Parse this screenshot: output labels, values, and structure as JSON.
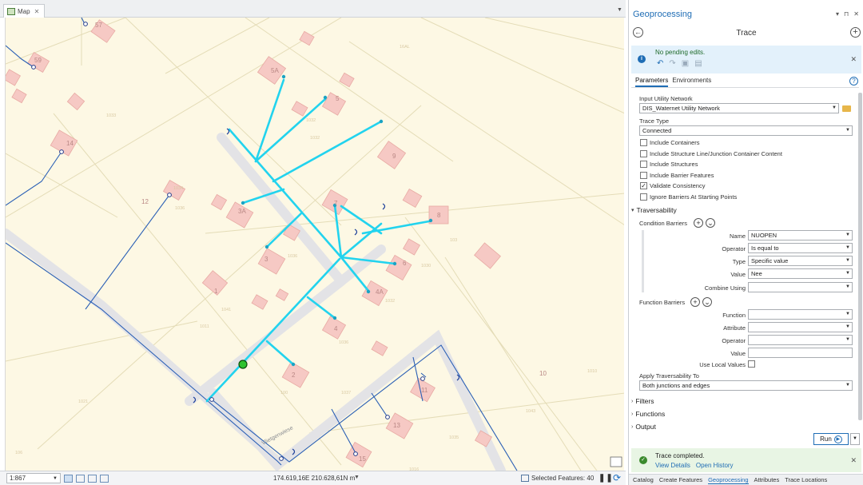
{
  "map_tab": {
    "label": "Map"
  },
  "map": {
    "parcel_labels": [
      "57",
      "59",
      "14",
      "12",
      "5A",
      "5",
      "9",
      "3A",
      "3",
      "7",
      "8",
      "6",
      "1",
      "4A",
      "4",
      "2",
      "11",
      "13",
      "15",
      "10"
    ],
    "faint_labels": [
      "16AL",
      "1032",
      "1033",
      "1034",
      "1036",
      "1030",
      "1041",
      "1032",
      "1036",
      "100",
      "1037",
      "1021",
      "1010",
      "1043",
      "1035",
      "1016",
      "100",
      "106",
      "103",
      "1032",
      "1036",
      "1011"
    ],
    "street_label": "Vlietgenwiese"
  },
  "map_status": {
    "scale": "1:867",
    "coordinates": "174.619,16E 210.628,61N m",
    "selected_features": "Selected Features: 40"
  },
  "gp": {
    "title": "Geoprocessing",
    "header_ctrls": [
      "▾",
      "⊓",
      "✕"
    ],
    "tool_name": "Trace",
    "info": {
      "message": "No pending edits."
    },
    "tabs": [
      "Parameters",
      "Environments"
    ],
    "input_network_label": "Input Utility Network",
    "input_network_value": "DIS_Waternet Utility Network",
    "trace_type_label": "Trace Type",
    "trace_type_value": "Connected",
    "checkboxes": [
      {
        "label": "Include Containers",
        "checked": false
      },
      {
        "label": "Include Structure Line/Junction Container Content",
        "checked": false
      },
      {
        "label": "Include Structures",
        "checked": false
      },
      {
        "label": "Include Barrier Features",
        "checked": false
      },
      {
        "label": "Validate Consistency",
        "checked": true
      },
      {
        "label": "Ignore Barriers At Starting Points",
        "checked": false
      }
    ],
    "traversability_label": "Traversability",
    "condition_barriers_label": "Condition Barriers",
    "condition": {
      "name_label": "Name",
      "name_value": "NUOPEN",
      "operator_label": "Operator",
      "operator_value": "Is equal to",
      "type_label": "Type",
      "type_value": "Specific value",
      "value_label": "Value",
      "value_value": "Nee",
      "combine_label": "Combine Using",
      "combine_value": ""
    },
    "function_barriers_label": "Function Barriers",
    "function": {
      "function_label": "Function",
      "attribute_label": "Attribute",
      "operator_label": "Operator",
      "value_label": "Value",
      "local_values_label": "Use Local Values"
    },
    "apply_traversability_label": "Apply Traversability To",
    "apply_traversability_value": "Both junctions and edges",
    "sections": [
      "Filters",
      "Functions",
      "Output"
    ],
    "run_label": "Run",
    "result": {
      "message": "Trace completed.",
      "links": [
        "View Details",
        "Open History"
      ]
    },
    "bottom_tabs": [
      "Catalog",
      "Create Features",
      "Geoprocessing",
      "Attributes",
      "Trace Locations"
    ],
    "active_bottom_tab": "Geoprocessing",
    "colors": {
      "accent": "#1f6db5",
      "trace": "#22d3ee",
      "parcel": "#f6c9c4",
      "main": "#2a5fb5"
    }
  }
}
